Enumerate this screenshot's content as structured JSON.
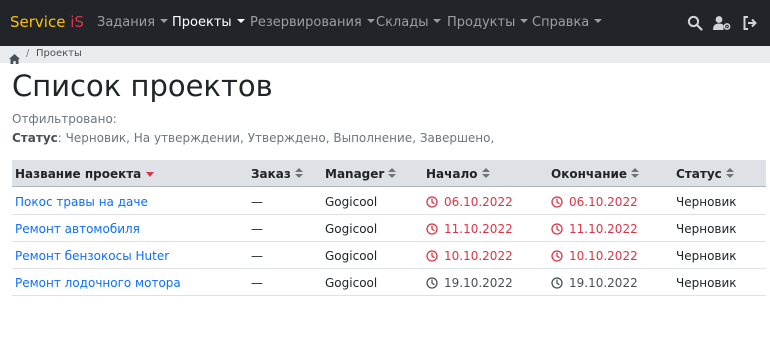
{
  "brand": {
    "part1": "Service",
    "part2": "iS"
  },
  "nav": {
    "items": [
      {
        "label": "Задания",
        "active": false
      },
      {
        "label": "Проекты",
        "active": true
      },
      {
        "label": "Резервирования",
        "active": false
      },
      {
        "label": "Склады",
        "active": false
      },
      {
        "label": "Продукты",
        "active": false
      },
      {
        "label": "Справка",
        "active": false
      }
    ],
    "icons": [
      "search-icon",
      "user-settings-icon",
      "logout-icon"
    ]
  },
  "breadcrumb": {
    "separator": "/",
    "current": "Проекты",
    "home_icon": "home-icon"
  },
  "page": {
    "title": "Список проектов",
    "filtered_label": "Отфильтровано:",
    "status_label": "Статус",
    "status_value": ": Черновик, На утверждении, Утверждено, Выполнение, Завершено,"
  },
  "table": {
    "columns": [
      "Название проекта",
      "Заказ",
      "Manager",
      "Начало",
      "Окончание",
      "Статус"
    ],
    "sorted_column": "Название проекта",
    "rows": [
      {
        "name": "Покос травы на даче",
        "order": "—",
        "manager": "Gogicool",
        "start": "06.10.2022",
        "end": "06.10.2022",
        "status": "Черновик",
        "overdue": true
      },
      {
        "name": "Ремонт автомобиля",
        "order": "—",
        "manager": "Gogicool",
        "start": "11.10.2022",
        "end": "11.10.2022",
        "status": "Черновик",
        "overdue": true
      },
      {
        "name": "Ремонт бензокосы Huter",
        "order": "—",
        "manager": "Gogicool",
        "start": "10.10.2022",
        "end": "10.10.2022",
        "status": "Черновик",
        "overdue": true
      },
      {
        "name": "Ремонт лодочного мотора",
        "order": "—",
        "manager": "Gogicool",
        "start": "19.10.2022",
        "end": "19.10.2022",
        "status": "Черновик",
        "overdue": false
      }
    ]
  },
  "colors": {
    "navbar": "#212529",
    "brand": "#ffc107",
    "accent": "#dc3545",
    "link": "#0d6efd"
  }
}
